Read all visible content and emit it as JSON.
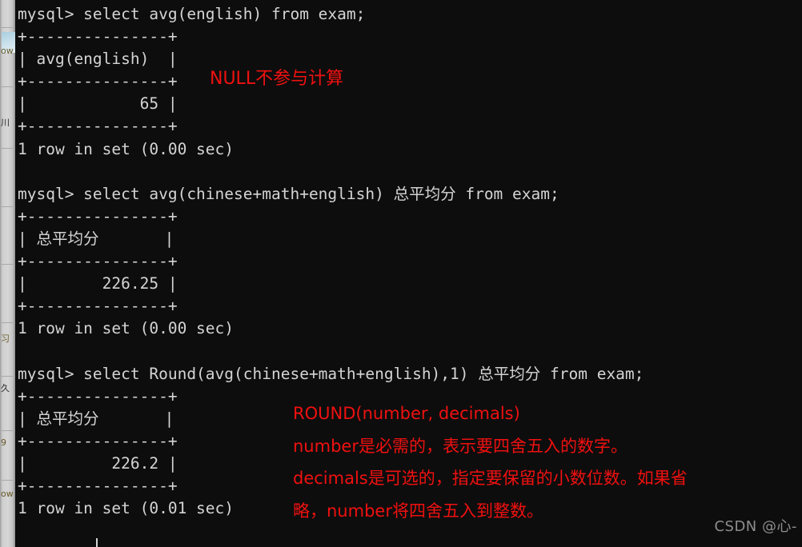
{
  "window": {
    "title": "mysql command line client",
    "background_color": "#0d0d0d",
    "text_color": "#d4d4d4",
    "annotation_color": "#f01010"
  },
  "left_sliver": {
    "fragments": [
      "ow",
      "川",
      "习",
      "久",
      "9",
      "ow"
    ]
  },
  "terminal": {
    "lines": [
      "mysql> select avg(english) from exam;",
      "+---------------+",
      "| avg(english)  |",
      "+---------------+",
      "|            65 |",
      "+---------------+",
      "1 row in set (0.00 sec)",
      "",
      "mysql> select avg(chinese+math+english) 总平均分 from exam;",
      "+---------------+",
      "| 总平均分       |",
      "+---------------+",
      "|        226.25 |",
      "+---------------+",
      "1 row in set (0.00 sec)",
      "",
      "mysql> select Round(avg(chinese+math+english),1) 总平均分 from exam;",
      "+---------------+",
      "| 总平均分       |",
      "+---------------+",
      "|         226.2 |",
      "+---------------+",
      "1 row in set (0.01 sec)"
    ]
  },
  "annotations": {
    "null_note": "NULL不参与计算",
    "round_signature": "ROUND(number, decimals)",
    "number_desc": "number是必需的，表示要四舍五入的数字。",
    "decimals_desc": "decimals是可选的，指定要保留的小数位数。如果省",
    "decimals_desc_cont": "略，number将四舍五入到整数。"
  },
  "watermark": {
    "text": "CSDN @心-"
  }
}
